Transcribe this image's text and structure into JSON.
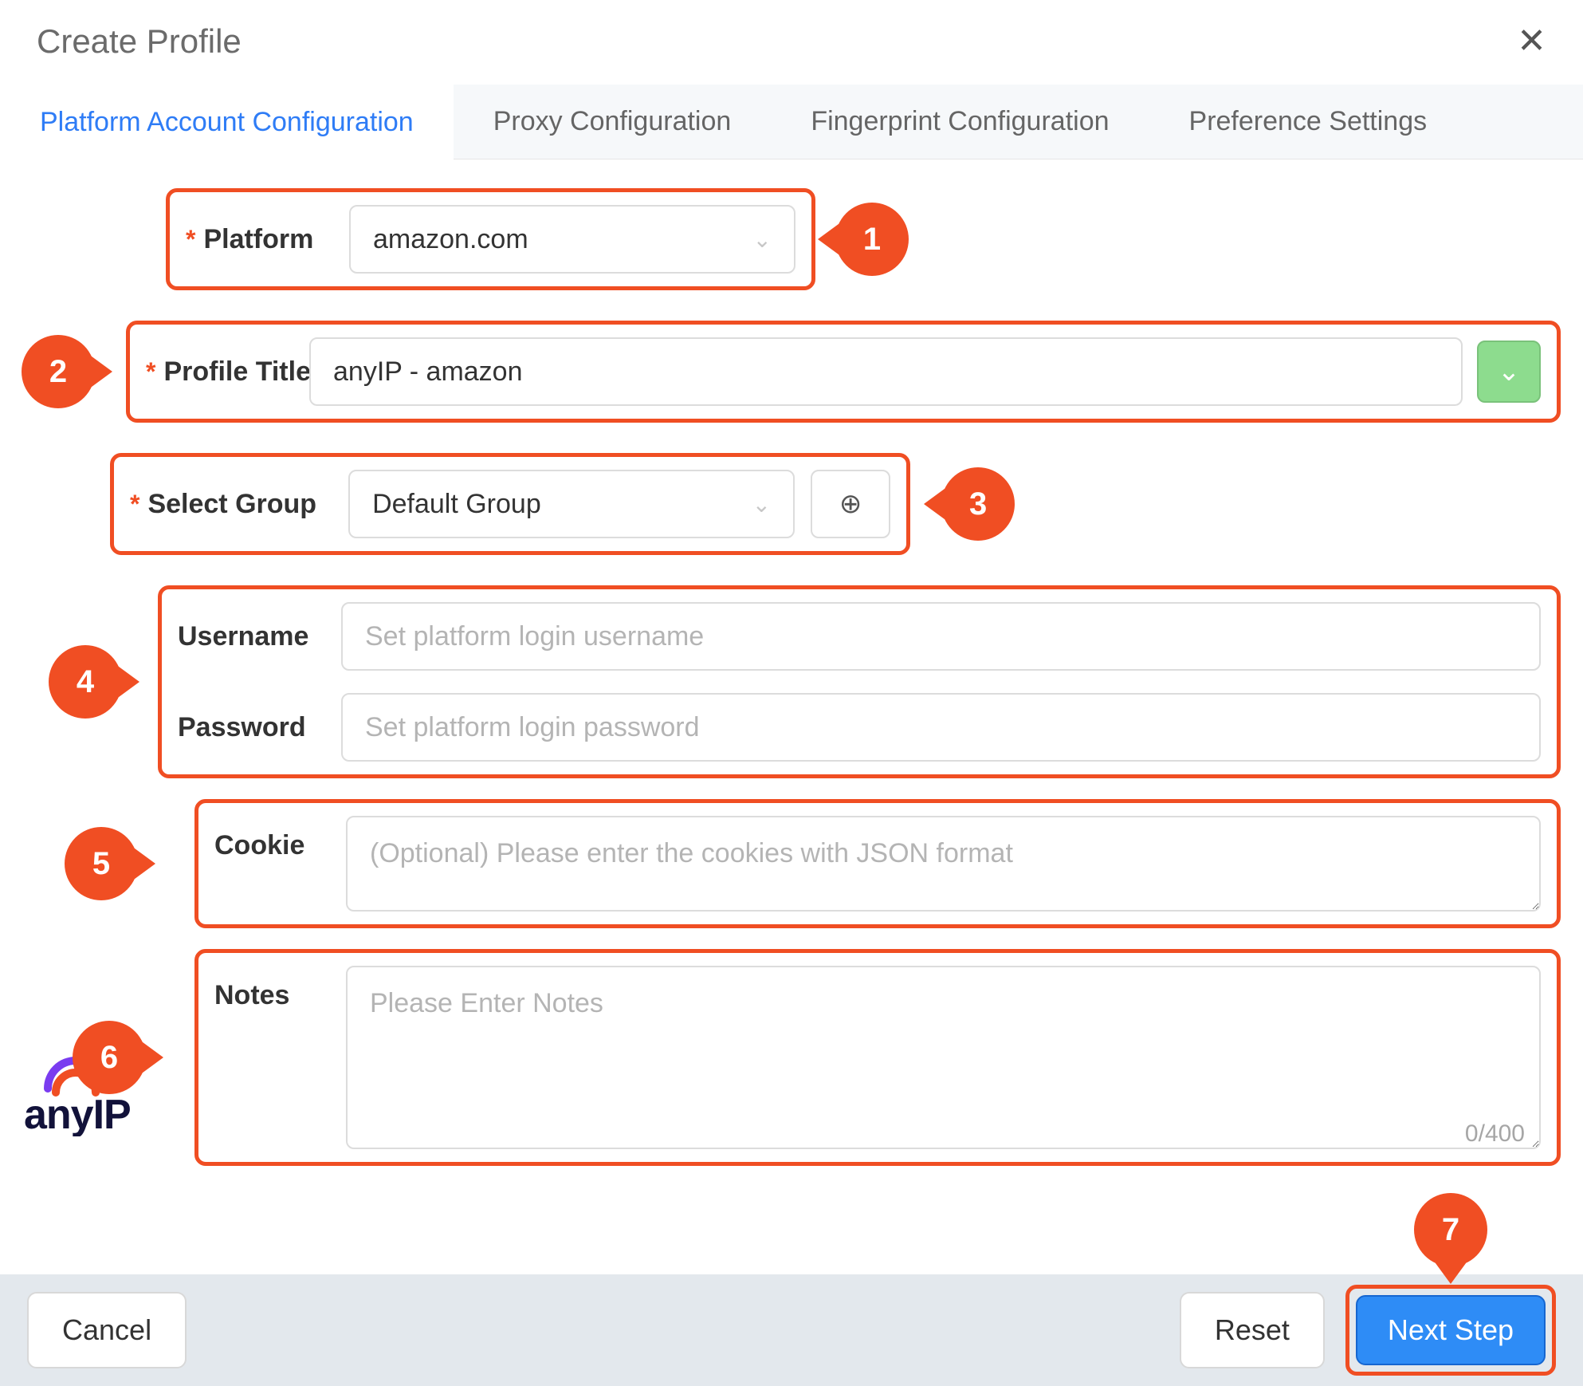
{
  "header": {
    "title": "Create Profile"
  },
  "tabs": [
    {
      "label": "Platform Account Configuration",
      "active": true
    },
    {
      "label": "Proxy Configuration",
      "active": false
    },
    {
      "label": "Fingerprint Configuration",
      "active": false
    },
    {
      "label": "Preference Settings",
      "active": false
    }
  ],
  "form": {
    "platform": {
      "label": "Platform",
      "value": "amazon.com",
      "required": true
    },
    "profileTitle": {
      "label": "Profile Title",
      "value": "anyIP - amazon",
      "required": true
    },
    "selectGroup": {
      "label": "Select Group",
      "value": "Default Group",
      "required": true
    },
    "username": {
      "label": "Username",
      "placeholder": "Set platform login username",
      "value": ""
    },
    "password": {
      "label": "Password",
      "placeholder": "Set platform login password",
      "value": ""
    },
    "cookie": {
      "label": "Cookie",
      "placeholder": "(Optional) Please enter the cookies with JSON format",
      "value": ""
    },
    "notes": {
      "label": "Notes",
      "placeholder": "Please Enter Notes",
      "value": "",
      "counter": "0/400"
    }
  },
  "buttons": {
    "cancel": "Cancel",
    "reset": "Reset",
    "next": "Next Step"
  },
  "logo": {
    "text": "anyIP"
  },
  "badges": {
    "b1": "1",
    "b2": "2",
    "b3": "3",
    "b4": "4",
    "b5": "5",
    "b6": "6",
    "b7": "7"
  },
  "colors": {
    "accent": "#f04e23",
    "primaryBlue": "#2e8cf6",
    "tabActive": "#2e7cf6"
  }
}
